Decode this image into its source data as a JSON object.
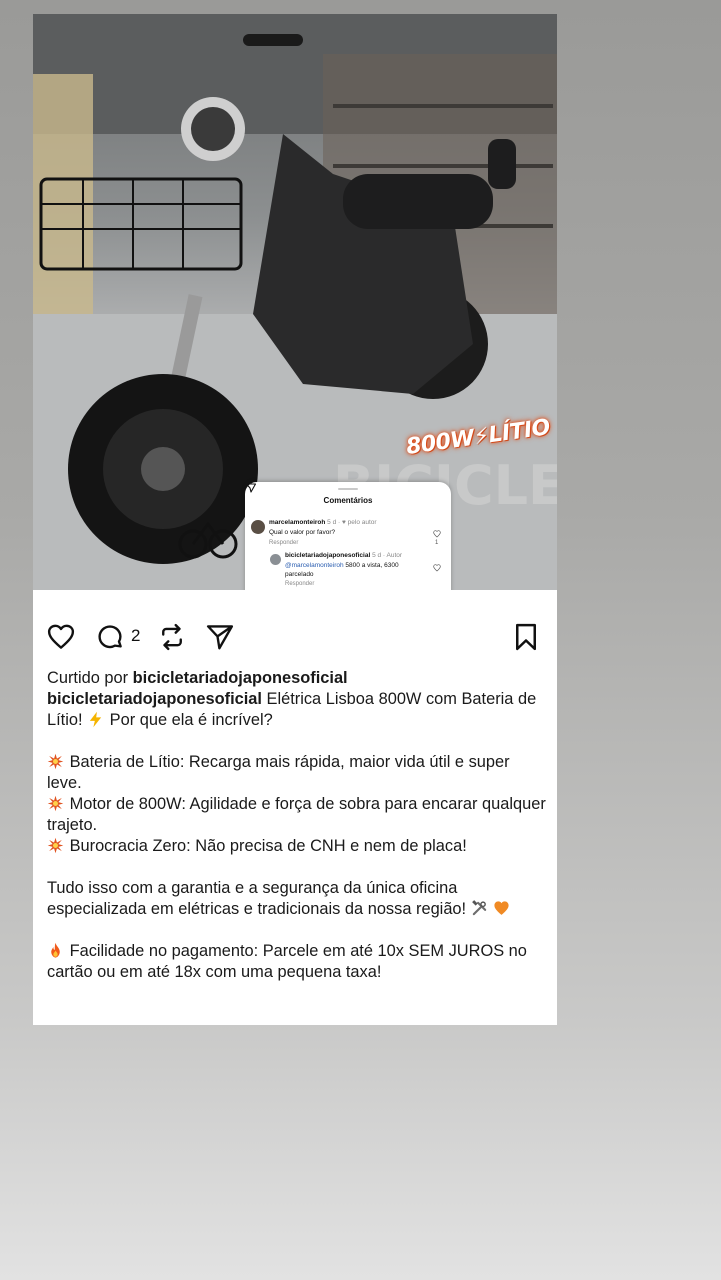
{
  "photo": {
    "badge_text": "800W⚡LÍTIO",
    "watermark": "BICICLETARIA"
  },
  "comments_panel": {
    "title": "Comentários",
    "comment": {
      "username": "marcelamonteiroh",
      "meta": "5 d · ♥ pelo autor",
      "text": "Qual o valor por favor?",
      "reply_label": "Responder",
      "like_count": "1"
    },
    "reply": {
      "username": "bicicletariadojaponesoficial",
      "meta": "5 d · Autor",
      "mention": "@marcelamonteiroh",
      "text_line1": " 5800 a vista, 6300",
      "text_line2": "parcelado",
      "reply_label": "Responder"
    }
  },
  "actions": {
    "comment_count": "2"
  },
  "post": {
    "liked_prefix": "Curtido por ",
    "liked_by": "bicicletariadojaponesoficial",
    "caption_user": "bicicletariadojaponesoficial",
    "caption_intro": " Elétrica Lisboa 800W com Bateria de Lítio! ",
    "caption_intro_end": " Por que ela é incrível?",
    "bullet1": "Bateria de Lítio: Recarga mais rápida, maior vida útil e super leve.",
    "bullet2": "Motor de 800W: Agilidade e força de sobra para encarar qualquer trajeto.",
    "bullet3": "Burocracia Zero: Não precisa de CNH e nem de placa!",
    "guarantee": "Tudo isso com a garantia e a segurança da única oficina especializada em elétricas e tradicionais da nossa região! ",
    "payment": "Facilidade no pagamento: Parcele em até 10x SEM JUROS no cartão ou em até 18x com uma pequena taxa!"
  },
  "colors": {
    "accent_orange": "#e0521f",
    "mention_blue": "#2a5db0",
    "heart_red": "#e0245e"
  }
}
